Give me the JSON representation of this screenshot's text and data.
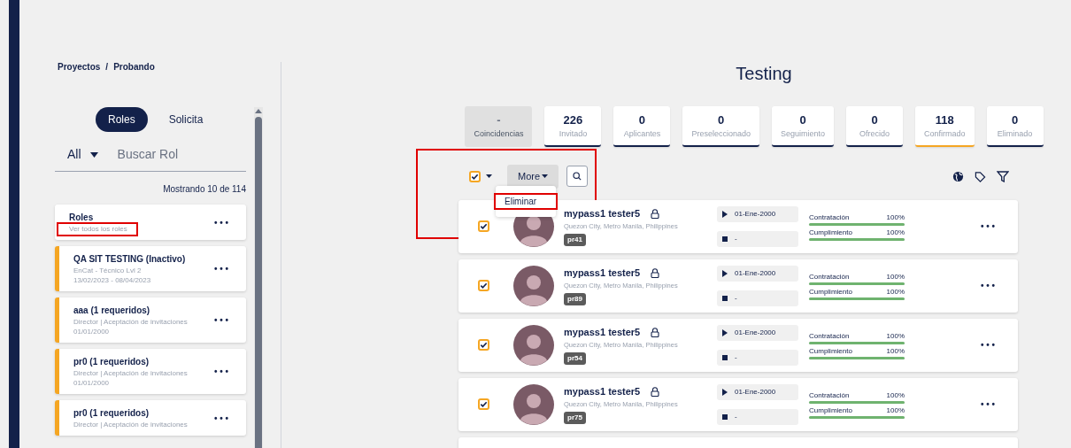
{
  "breadcrumb": {
    "items": [
      "Proyectos",
      "Probando"
    ],
    "separator": "/"
  },
  "left_tabs": [
    {
      "label": "Roles",
      "selected": true
    },
    {
      "label": "Solicita",
      "selected": false
    }
  ],
  "filter": {
    "value": "All",
    "placeholder": "Buscar Rol"
  },
  "count_text": "Mostrando 10 de 114",
  "roles": [
    {
      "kind": "all",
      "title": "Roles",
      "lines": [
        "Ver todos los roles"
      ],
      "menu": "• • •"
    },
    {
      "kind": "role",
      "title": "QA SIT TESTING (Inactivo)",
      "lines": [
        "EnCat - Técnico Lvl 2",
        "13/02/2023 - 08/04/2023"
      ],
      "menu": "• • •"
    },
    {
      "kind": "role",
      "title": "aaa (1 requeridos)",
      "lines": [
        "Director | Aceptación de invitaciones",
        "01/01/2000"
      ],
      "menu": "• • •"
    },
    {
      "kind": "role",
      "title": "pr0 (1 requeridos)",
      "lines": [
        "Director | Aceptación de invitaciones",
        "01/01/2000"
      ],
      "menu": "• • •"
    },
    {
      "kind": "role",
      "title": "pr0 (1 requeridos)",
      "lines": [
        "Director | Aceptación de invitaciones"
      ],
      "menu": "• • •"
    }
  ],
  "title": "Testing",
  "stats": [
    {
      "kind": "total",
      "value": "-",
      "label": "Coincidencias",
      "selected": false
    },
    {
      "kind": "stage",
      "value": "226",
      "label": "Invitado",
      "selected": false
    },
    {
      "kind": "stage",
      "value": "0",
      "label": "Aplicantes",
      "selected": false
    },
    {
      "kind": "stage",
      "value": "0",
      "label": "Preseleccionado",
      "selected": false
    },
    {
      "kind": "stage",
      "value": "0",
      "label": "Seguimiento",
      "selected": false
    },
    {
      "kind": "stage",
      "value": "0",
      "label": "Ofrecido",
      "selected": false
    },
    {
      "kind": "stage",
      "value": "118",
      "label": "Confirmado",
      "selected": true
    },
    {
      "kind": "stage",
      "value": "0",
      "label": "Eliminado",
      "selected": false
    }
  ],
  "toolbar": {
    "select_all_checked": true,
    "more_label": "More",
    "menu_items": [
      "Eliminar"
    ]
  },
  "candidates": [
    {
      "checked": true,
      "name": "mypass1 tester5",
      "location": "Quezon City, Metro Manila, Philippines",
      "tag": "pr41",
      "start": "01-Ene-2000",
      "end": "-",
      "metrics": [
        {
          "label": "Contratación",
          "reading": "100%",
          "level": 1
        },
        {
          "label": "Cumplimiento",
          "reading": "100%",
          "level": 1
        }
      ],
      "menu": "• • •"
    },
    {
      "checked": true,
      "name": "mypass1 tester5",
      "location": "Quezon City, Metro Manila, Philippines",
      "tag": "pr89",
      "start": "01-Ene-2000",
      "end": "-",
      "metrics": [
        {
          "label": "Contratación",
          "reading": "100%",
          "level": 1
        },
        {
          "label": "Cumplimiento",
          "reading": "100%",
          "level": 1
        }
      ],
      "menu": "• • •"
    },
    {
      "checked": true,
      "name": "mypass1 tester5",
      "location": "Quezon City, Metro Manila, Philippines",
      "tag": "pr54",
      "start": "01-Ene-2000",
      "end": "-",
      "metrics": [
        {
          "label": "Contratación",
          "reading": "100%",
          "level": 1
        },
        {
          "label": "Cumplimiento",
          "reading": "100%",
          "level": 1
        }
      ],
      "menu": "• • •"
    },
    {
      "checked": true,
      "name": "mypass1 tester5",
      "location": "Quezon City, Metro Manila, Philippines",
      "tag": "pr75",
      "start": "01-Ene-2000",
      "end": "-",
      "metrics": [
        {
          "label": "Contratación",
          "reading": "100%",
          "level": 1
        },
        {
          "label": "Cumplimiento",
          "reading": "100%",
          "level": 1
        }
      ],
      "menu": "• • •"
    }
  ]
}
